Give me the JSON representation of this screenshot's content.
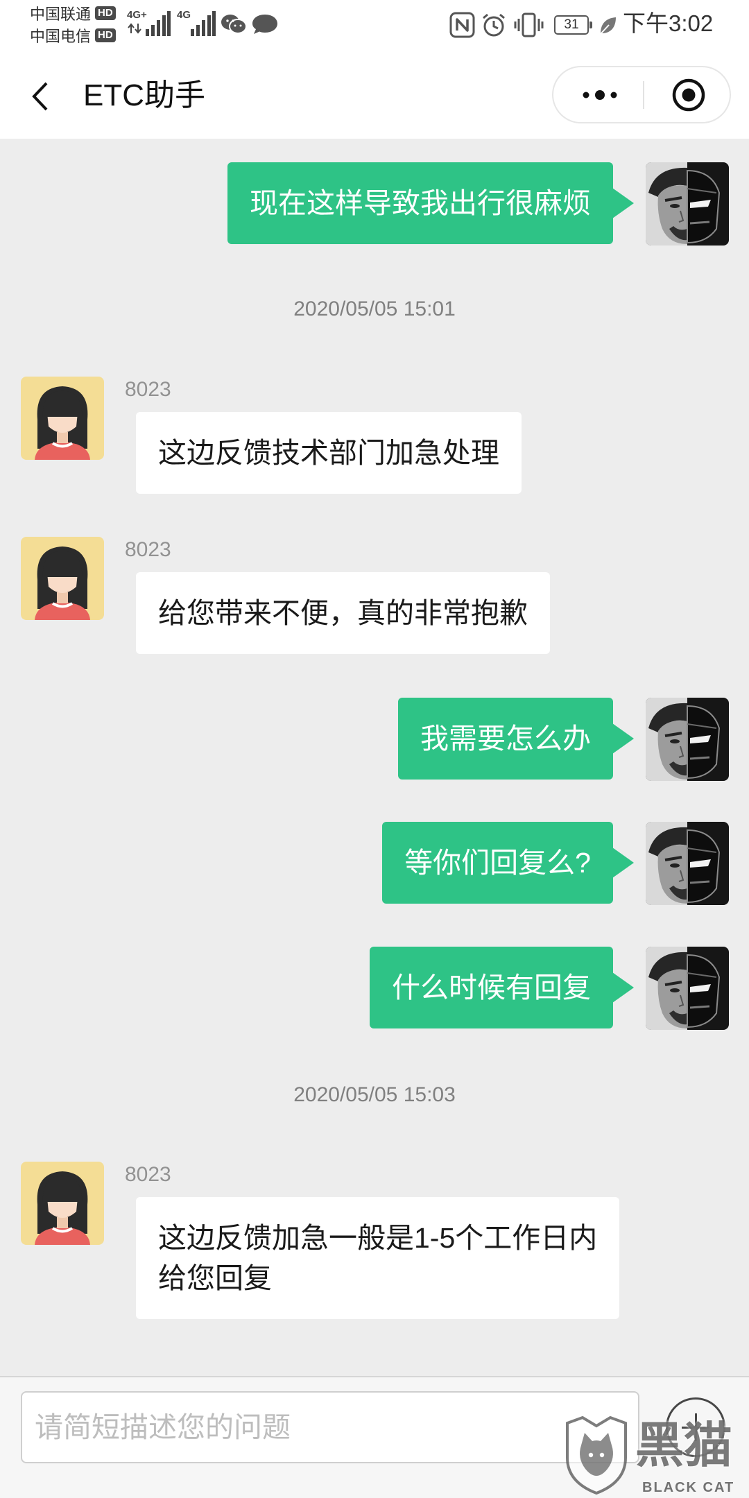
{
  "status_bar": {
    "carriers": [
      {
        "name": "中国联通",
        "badge": "HD"
      },
      {
        "name": "中国电信",
        "badge": "HD"
      }
    ],
    "networks": [
      "4G+",
      "4G"
    ],
    "battery_level": "31",
    "time": "下午3:02",
    "icons": [
      "signal-bars-icon",
      "wechat-icon",
      "message-icon",
      "nfc-icon",
      "alarm-icon",
      "vibrate-icon",
      "battery-icon",
      "leaf-icon"
    ]
  },
  "nav": {
    "title": "ETC助手",
    "icons": {
      "back": "chevron-left-icon",
      "more": "more-dots-icon",
      "close": "target-circle-icon"
    }
  },
  "messages": [
    {
      "kind": "outgoing",
      "text": "现在这样导致我出行很麻烦"
    },
    {
      "kind": "timestamp",
      "text": "2020/05/05 15:01"
    },
    {
      "kind": "incoming",
      "name": "8023",
      "text": "这边反馈技术部门加急处理"
    },
    {
      "kind": "incoming",
      "name": "8023",
      "text": "给您带来不便，真的非常抱歉"
    },
    {
      "kind": "outgoing",
      "text": "我需要怎么办"
    },
    {
      "kind": "outgoing",
      "text": "等你们回复么?"
    },
    {
      "kind": "outgoing",
      "text": "什么时候有回复"
    },
    {
      "kind": "timestamp",
      "text": "2020/05/05 15:03"
    },
    {
      "kind": "incoming",
      "name": "8023",
      "lines": [
        "这边反馈加急一般是1-5个工作日内",
        "给您回复"
      ]
    }
  ],
  "input": {
    "placeholder": "请简短描述您的问题",
    "add_icon": "plus-circle-icon"
  },
  "watermark": {
    "logo_icon": "black-cat-logo-icon",
    "logo_text": "黑猫",
    "logo_subtext": "BLACK CAT"
  },
  "colors": {
    "outgoing_bubble": "#2ec386",
    "incoming_bubble": "#ffffff",
    "chat_background": "#ededed",
    "timestamp_text": "#808080"
  }
}
